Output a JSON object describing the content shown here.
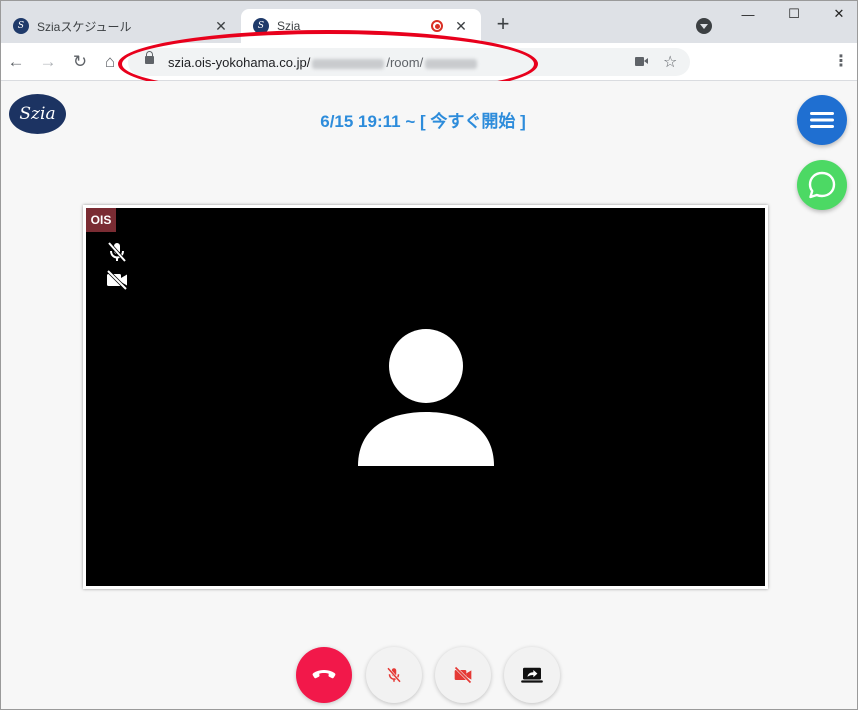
{
  "browser": {
    "tabs": [
      {
        "title": "Sziaスケジュール",
        "favicon": "S",
        "active": false,
        "recording": false
      },
      {
        "title": "Szia",
        "favicon": "S",
        "active": true,
        "recording": true
      }
    ],
    "new_tab_symbol": "+",
    "close_symbol": "✕",
    "window_controls": {
      "minimize": "—",
      "maximize": "☐",
      "close": "✕"
    },
    "address_bar": {
      "host": "szia.ois-yokohama.co.jp/",
      "path_mid": "/room/",
      "icons": [
        "lock-icon",
        "camera-icon",
        "star-icon"
      ]
    },
    "nav": {
      "back": "←",
      "forward": "→",
      "reload": "↻",
      "home": "⌂",
      "menu": "⋮",
      "star": "☆"
    }
  },
  "page": {
    "logo_text": "Szia",
    "schedule_text": "6/15 19:11 ~ [ 今すぐ開始 ]",
    "participant": {
      "name_tag": "OIS",
      "mic_muted": true,
      "camera_off": true
    },
    "controls": [
      "hangup-button",
      "mic-toggle-button",
      "camera-toggle-button",
      "screen-share-button"
    ]
  },
  "colors": {
    "accent_blue": "#2d8cdb",
    "menu_fab": "#1f6fd1",
    "chat_fab": "#4cd964",
    "hangup": "#f2184a",
    "muted_red": "#e53935",
    "annotation_red": "#e8001c",
    "name_tag": "#7a2c33"
  }
}
